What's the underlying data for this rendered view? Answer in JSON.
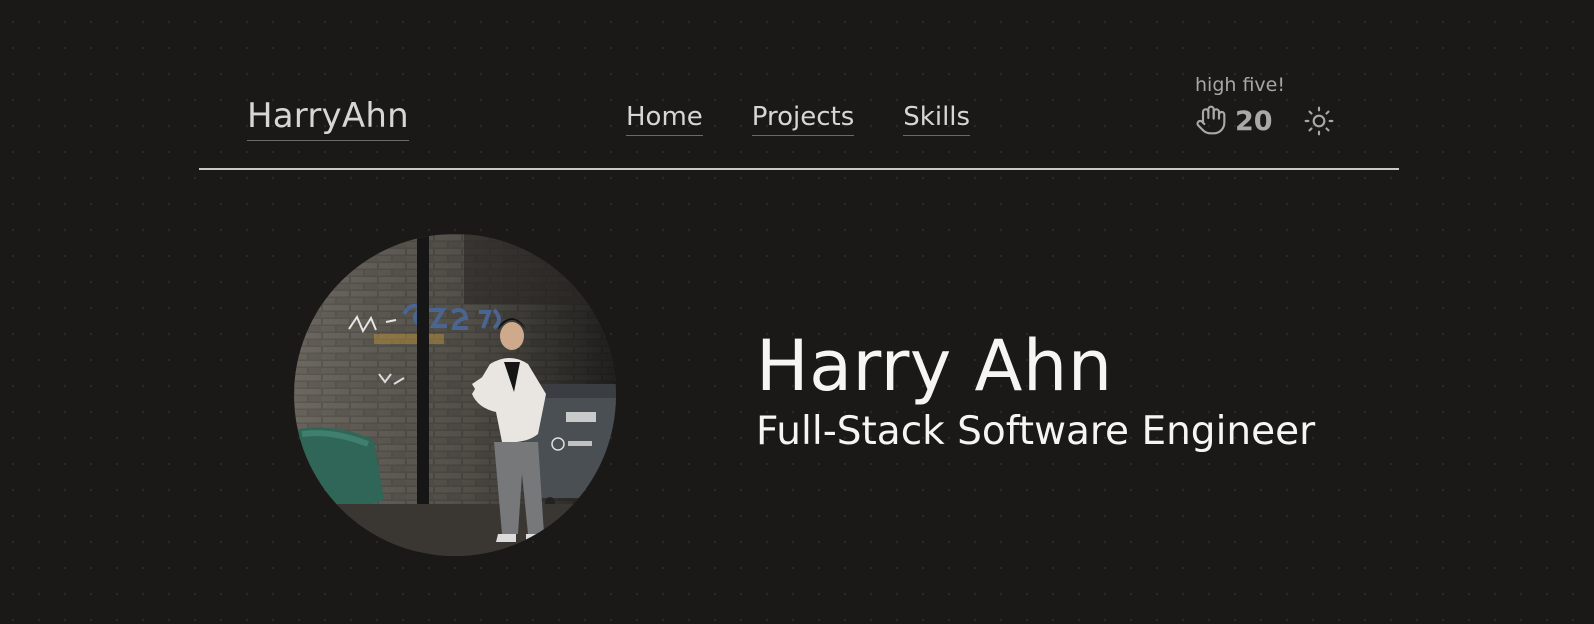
{
  "header": {
    "brand": "HarryAhn",
    "nav": [
      {
        "label": "Home"
      },
      {
        "label": "Projects"
      },
      {
        "label": "Skills"
      }
    ],
    "high_five": {
      "label": "high five!",
      "count": "20",
      "icon": "hand-icon"
    },
    "theme_toggle": {
      "icon": "sun-icon"
    }
  },
  "hero": {
    "name": "Harry Ahn",
    "title": "Full-Stack Software Engineer",
    "photo": {
      "shape": "circle",
      "description": "profile photo"
    }
  },
  "colors": {
    "background": "#1b1918",
    "text": "#f5f5f5",
    "muted": "#a9a9a9",
    "divider": "#c9c9c9"
  }
}
